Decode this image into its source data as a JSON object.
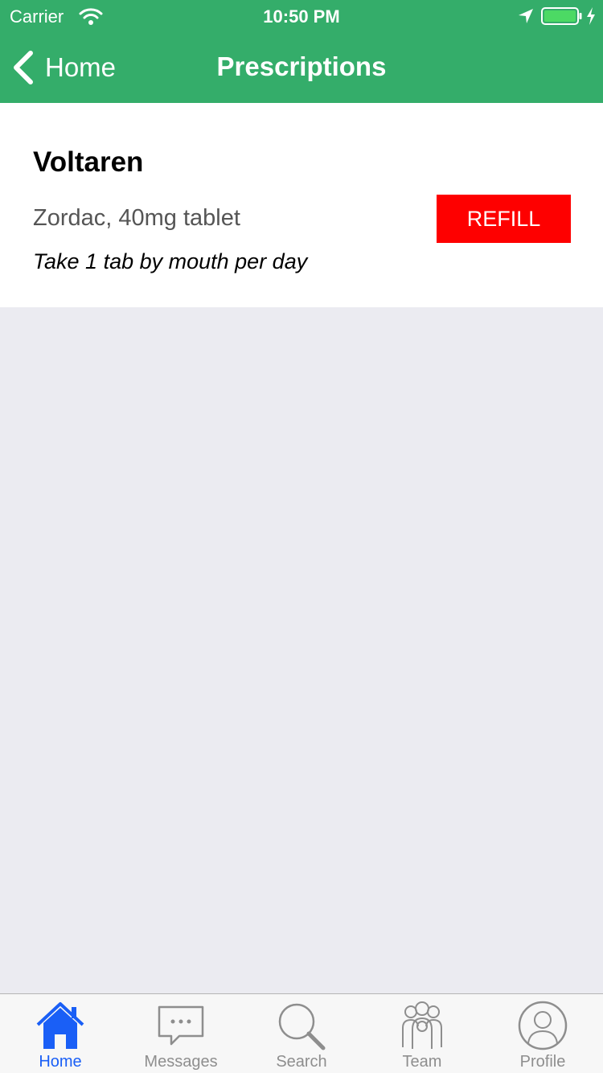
{
  "status_bar": {
    "carrier": "Carrier",
    "time": "10:50 PM",
    "icons": [
      "wifi-icon",
      "location-arrow-icon",
      "battery-icon",
      "charging-bolt-icon"
    ]
  },
  "nav": {
    "back_label": "Home",
    "title": "Prescriptions"
  },
  "prescription": {
    "name": "Voltaren",
    "detail": "Zordac, 40mg tablet",
    "instructions": "Take 1 tab by mouth per day",
    "refill_label": "REFILL"
  },
  "tabs": [
    {
      "label": "Home",
      "icon": "home-icon",
      "active": true
    },
    {
      "label": "Messages",
      "icon": "chat-bubble-icon",
      "active": false
    },
    {
      "label": "Search",
      "icon": "magnifier-icon",
      "active": false
    },
    {
      "label": "Team",
      "icon": "team-icon",
      "active": false
    },
    {
      "label": "Profile",
      "icon": "user-circle-icon",
      "active": false
    }
  ],
  "colors": {
    "header": "#34ad6a",
    "refill": "#fe0000",
    "active_tab": "#1a5ff6",
    "inactive_tab": "#8e8e8e",
    "background": "#ebebf1"
  }
}
